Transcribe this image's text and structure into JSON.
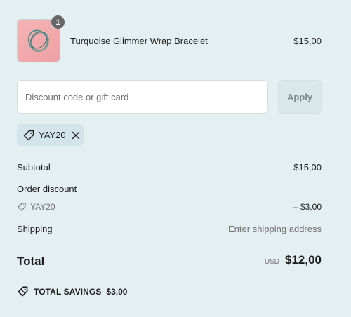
{
  "cart": {
    "product": {
      "name": "Turquoise Glimmer Wrap Bracelet",
      "price": "$15,00",
      "quantity": "1",
      "thumbnail_bg": "#f3aeb0"
    }
  },
  "discount": {
    "placeholder": "Discount code or gift card",
    "value": "",
    "apply_label": "Apply",
    "applied_code": "YAY20"
  },
  "summary": {
    "subtotal_label": "Subtotal",
    "subtotal_value": "$15,00",
    "order_discount_label": "Order discount",
    "discount_code": "YAY20",
    "discount_value": "– $3,00",
    "shipping_label": "Shipping",
    "shipping_value": "Enter shipping address",
    "total_label": "Total",
    "currency": "USD",
    "total_value": "$12,00",
    "savings_label": "TOTAL SAVINGS",
    "savings_value": "$3,00"
  },
  "colors": {
    "background": "#e4eff2",
    "text": "#1b1b1b",
    "muted": "#707070",
    "chip": "#d3e5eb",
    "apply_button": "#dae7eb"
  },
  "icons": {
    "tag": "tag-icon",
    "remove": "close-icon",
    "savings": "savings-tag-icon"
  }
}
